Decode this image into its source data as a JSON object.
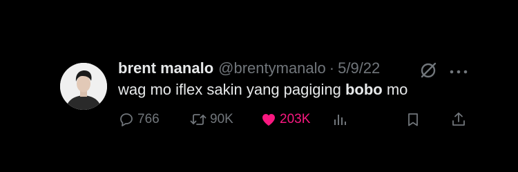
{
  "author": {
    "display_name": "brent manalo",
    "handle": "@brentymanalo",
    "separator": "·",
    "date": "5/9/22"
  },
  "tweet": {
    "text_before": "wag mo iflex sakin yang pagiging ",
    "text_bold": "bobo",
    "text_after": " mo"
  },
  "actions": {
    "replies": "766",
    "retweets": "90K",
    "likes": "203K"
  },
  "icons": {
    "grok": "grok-icon",
    "more": "more-icon",
    "reply": "reply-icon",
    "retweet": "retweet-icon",
    "like": "heart-icon",
    "views": "views-icon",
    "bookmark": "bookmark-icon",
    "share": "share-icon"
  },
  "colors": {
    "background": "#000000",
    "primary_text": "#e7e9ea",
    "secondary_text": "#71767b",
    "like": "#f91880"
  }
}
